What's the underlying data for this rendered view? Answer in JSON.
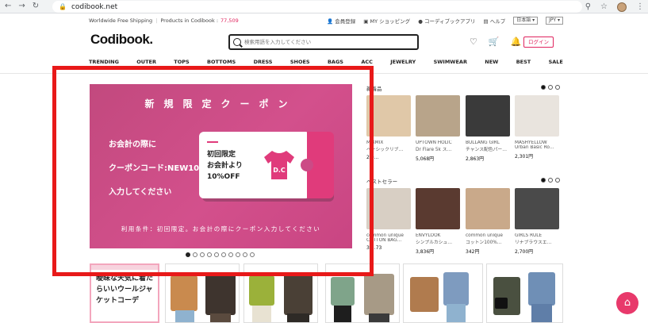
{
  "browser": {
    "url": "codibook.net",
    "back": "←",
    "forward": "→",
    "reload": "↻"
  },
  "topbar": {
    "shipping": "Worldwide Free Shipping",
    "products_label": "Products in Codibook :",
    "products_count": "77,509",
    "signup": "会員登録",
    "my_shopping": "MY ショッピング",
    "coordi_app": "コーディブックアプリ",
    "help": "ヘルプ",
    "language": "日本語",
    "currency": "JPY"
  },
  "header": {
    "logo": "Codibook.",
    "search_placeholder": "検索用語を入力してください",
    "login": "ログイン"
  },
  "nav": [
    "TRENDING",
    "OUTER",
    "TOPS",
    "BOTTOMS",
    "DRESS",
    "SHOES",
    "BAGS",
    "ACC",
    "JEWELRY",
    "SWIMWEAR",
    "NEW",
    "BEST",
    "SALE"
  ],
  "banner": {
    "title": "新規限定クーポン",
    "line1": "お会計の際に",
    "line2": "クーポンコード:NEW10",
    "line3": "入力してください",
    "ticket_line1": "初回限定",
    "ticket_line2": "お会計より",
    "ticket_line3": "10%OFF",
    "ticket_badge": "D.C",
    "footer": "利用条件：初回限定。お会計の際にクーポン入力してください",
    "slides_total": 10,
    "slide_active": 1
  },
  "new_products": {
    "title": "新着品",
    "items": [
      {
        "brand": "MIXMIX",
        "name": "ベーシックリブ…",
        "price": "2,0…",
        "color": "#e0c8a8"
      },
      {
        "brand": "UPTOWN HOLIC",
        "name": "Dr Flare 5k ス…",
        "price": "5,068円",
        "color": "#b8a48a"
      },
      {
        "brand": "BULLANG GIRL",
        "name": "チャンス配色パー…",
        "price": "2,863円",
        "color": "#3a3a3a"
      },
      {
        "brand": "MASHYELLOW",
        "name": "Urban Basic Ro…",
        "price": "2,301円",
        "color": "#e9e4de"
      }
    ]
  },
  "best_sellers": {
    "title": "ベストセラー",
    "items": [
      {
        "brand": "common unique",
        "name": "COTTON BAG…",
        "price": "3,…73",
        "color": "#d8cfc4"
      },
      {
        "brand": "ENVYLOOK",
        "name": "シンプルカシュ…",
        "price": "3,836円",
        "color": "#5a3a30"
      },
      {
        "brand": "common unique",
        "name": "コットン100%…",
        "price": "342円",
        "color": "#c9a98a"
      },
      {
        "brand": "GIRLS RULE",
        "name": "リナブラウスエ…",
        "price": "2,700円",
        "color": "#4a4a4a"
      }
    ]
  },
  "coordi_card": {
    "text1": "曖昧な天気に着た",
    "text2": "らいいウールジャ",
    "text3": "ケットコーデ"
  },
  "colors": {
    "accent": "#e0245e",
    "highlight": "#e81919",
    "banner": "#c94582"
  }
}
